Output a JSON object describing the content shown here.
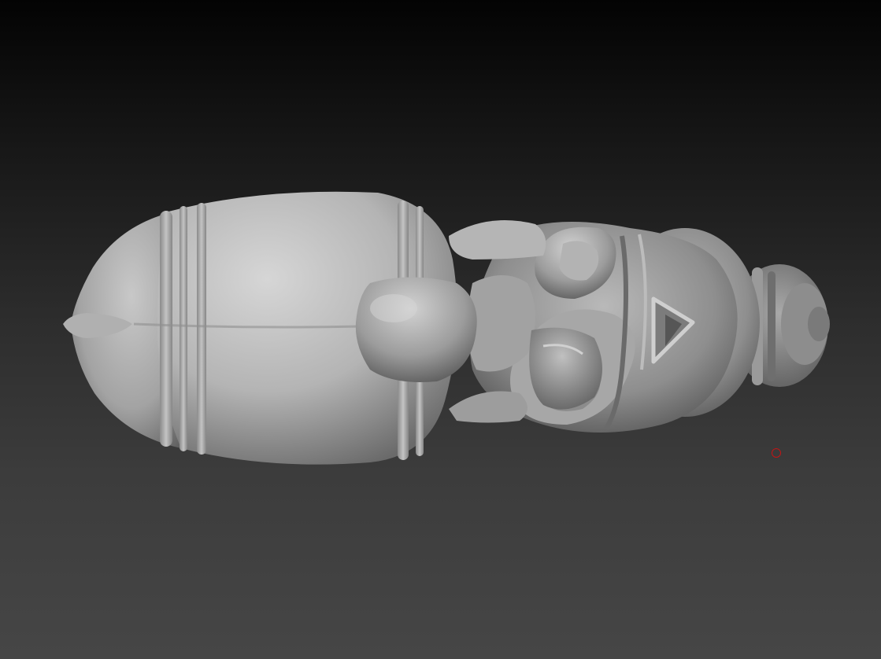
{
  "canvas": {
    "background_top": "#030303",
    "background_bottom": "#464646",
    "material_color": "#bdbdbd"
  },
  "model": {
    "icon": "sculpted-3d-model",
    "description_shown": ""
  },
  "cursor": {
    "icon": "brush-circle-icon",
    "color": "#c41414"
  }
}
